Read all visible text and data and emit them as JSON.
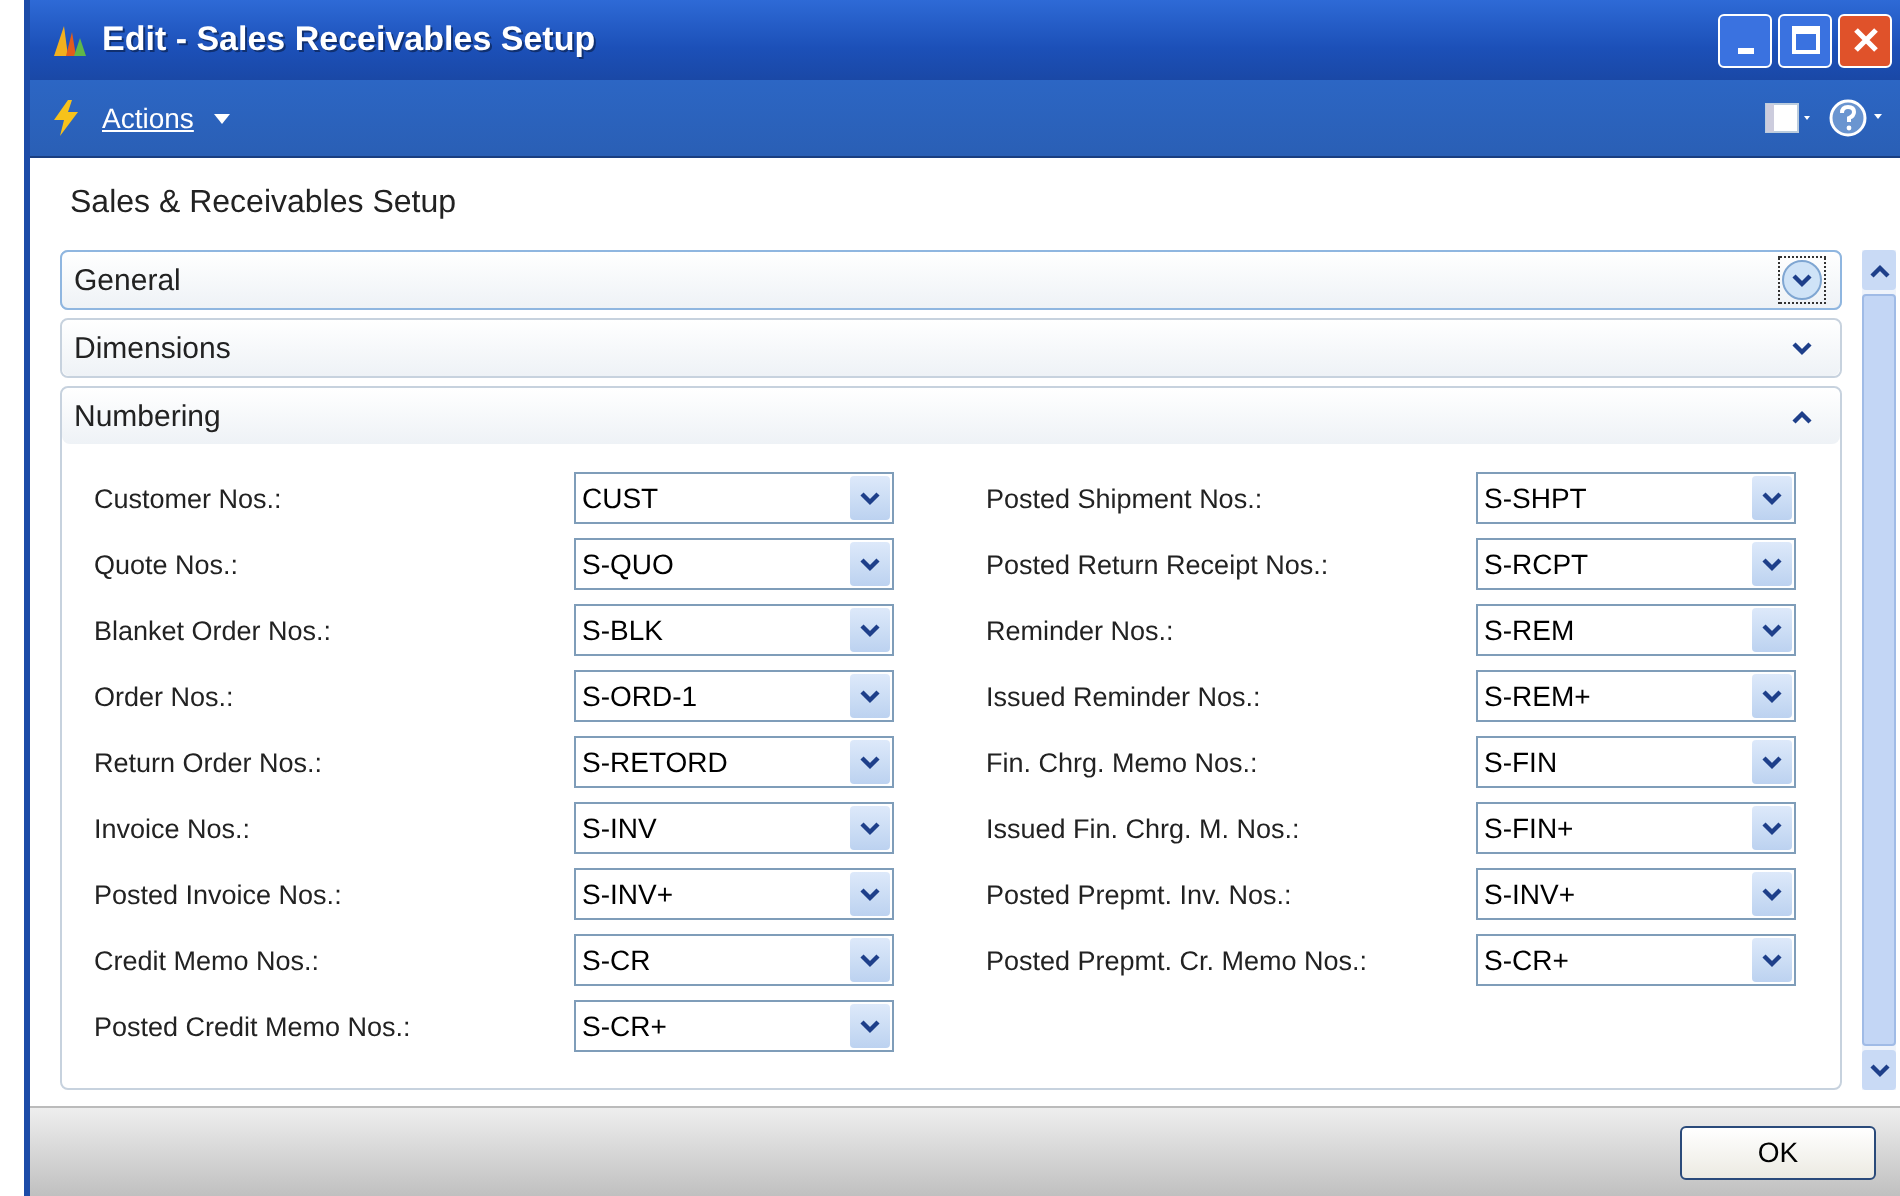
{
  "window": {
    "title": "Edit - Sales  Receivables Setup"
  },
  "toolbar": {
    "actions": "Actions"
  },
  "page_title": "Sales & Receivables Setup",
  "sections": [
    {
      "title": "General",
      "expanded": false,
      "focused": true
    },
    {
      "title": "Dimensions",
      "expanded": false,
      "focused": false
    },
    {
      "title": "Numbering",
      "expanded": true,
      "focused": false
    }
  ],
  "numbering": {
    "left": [
      {
        "label": "Customer Nos.:",
        "value": "CUST"
      },
      {
        "label": "Quote Nos.:",
        "value": "S-QUO"
      },
      {
        "label": "Blanket Order Nos.:",
        "value": "S-BLK"
      },
      {
        "label": "Order Nos.:",
        "value": "S-ORD-1"
      },
      {
        "label": "Return Order Nos.:",
        "value": "S-RETORD"
      },
      {
        "label": "Invoice Nos.:",
        "value": "S-INV"
      },
      {
        "label": "Posted Invoice Nos.:",
        "value": "S-INV+"
      },
      {
        "label": "Credit Memo Nos.:",
        "value": "S-CR"
      },
      {
        "label": "Posted Credit Memo Nos.:",
        "value": "S-CR+"
      }
    ],
    "right": [
      {
        "label": "Posted Shipment Nos.:",
        "value": "S-SHPT"
      },
      {
        "label": "Posted Return Receipt Nos.:",
        "value": "S-RCPT"
      },
      {
        "label": "Reminder Nos.:",
        "value": "S-REM"
      },
      {
        "label": "Issued Reminder Nos.:",
        "value": "S-REM+"
      },
      {
        "label": "Fin. Chrg. Memo Nos.:",
        "value": "S-FIN"
      },
      {
        "label": "Issued Fin. Chrg. M. Nos.:",
        "value": "S-FIN+"
      },
      {
        "label": "Posted Prepmt. Inv. Nos.:",
        "value": "S-INV+"
      },
      {
        "label": "Posted Prepmt. Cr. Memo Nos.:",
        "value": "S-CR+"
      }
    ]
  },
  "buttons": [
    "OK"
  ]
}
